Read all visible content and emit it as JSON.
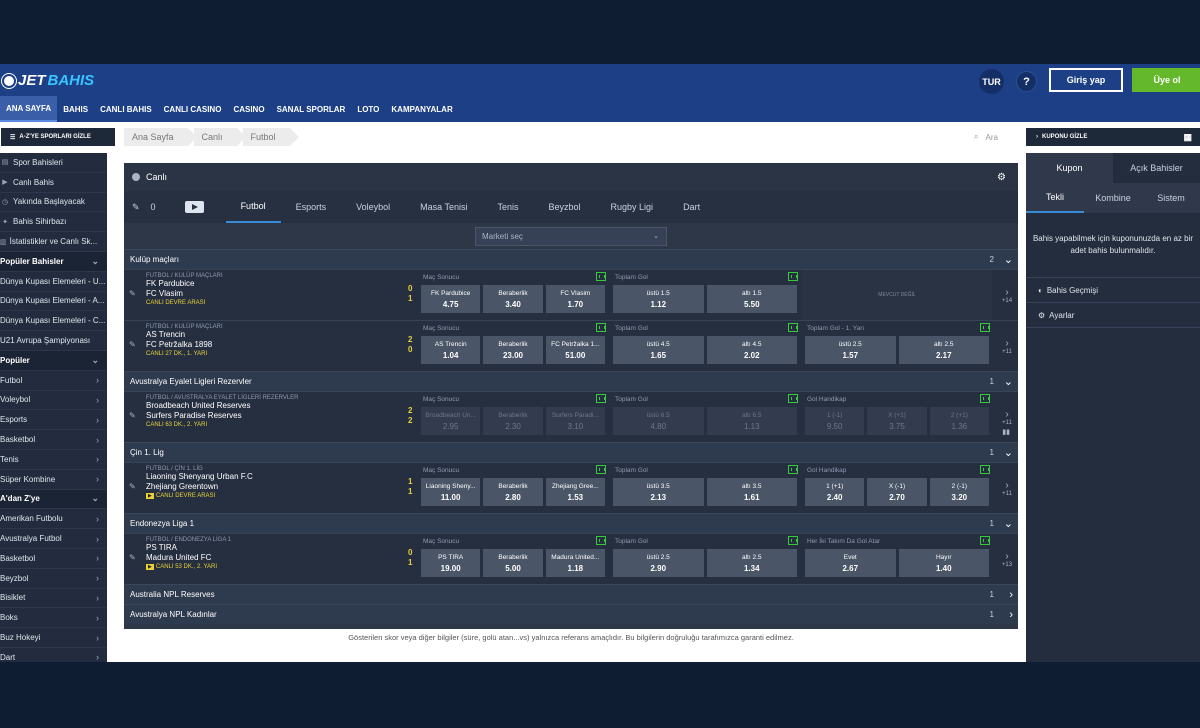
{
  "header": {
    "logo_part1": "JET",
    "logo_part2": "BAHIS",
    "language": "TUR",
    "help": "?",
    "login_label": "Giriş yap",
    "signup_label": "Üye ol"
  },
  "nav": [
    "ANA SAYFA",
    "BAHIS",
    "CANLI BAHIS",
    "CANLI CASINO",
    "CASINO",
    "SANAL SPORLAR",
    "LOTO",
    "KAMPANYALAR"
  ],
  "az_button": "A-Z'YE SPORLARI GİZLE",
  "breadcrumb": [
    "Ana Sayfa",
    "Canlı",
    "Futbol"
  ],
  "search_placeholder": "Ara",
  "kupon_hide": "KUPONU GİZLE",
  "left_menu": [
    {
      "label": "Spor Bahisleri",
      "type": "item",
      "icon": "▤"
    },
    {
      "label": "Canlı Bahis",
      "type": "item",
      "icon": "▶"
    },
    {
      "label": "Yakında Başlayacak",
      "type": "item",
      "icon": "◷"
    },
    {
      "label": "Bahis Sihirbazı",
      "type": "item",
      "icon": "✦"
    },
    {
      "label": "İstatistikler ve Canlı Sk...",
      "type": "item",
      "icon": "▥"
    },
    {
      "label": "Popüler Bahisler",
      "type": "hdr"
    },
    {
      "label": "Dünya Kupası Elemeleri - U...",
      "type": "item"
    },
    {
      "label": "Dünya Kupası Elemeleri - A...",
      "type": "item"
    },
    {
      "label": "Dünya Kupası Elemeleri - C...",
      "type": "item"
    },
    {
      "label": "U21 Avrupa Şampiyonası",
      "type": "item"
    },
    {
      "label": "Popüler",
      "type": "hdr"
    },
    {
      "label": "Futbol",
      "type": "item",
      "chev": true
    },
    {
      "label": "Voleybol",
      "type": "item",
      "chev": true
    },
    {
      "label": "Esports",
      "type": "item",
      "chev": true
    },
    {
      "label": "Basketbol",
      "type": "item",
      "chev": true
    },
    {
      "label": "Tenis",
      "type": "item",
      "chev": true
    },
    {
      "label": "Süper Kombine",
      "type": "item",
      "chev": true
    },
    {
      "label": "A'dan Z'ye",
      "type": "hdr"
    },
    {
      "label": "Amerikan Futbolu",
      "type": "item",
      "chev": true
    },
    {
      "label": "Avustralya Futbol",
      "type": "item",
      "chev": true
    },
    {
      "label": "Basketbol",
      "type": "item",
      "chev": true
    },
    {
      "label": "Beyzbol",
      "type": "item",
      "chev": true
    },
    {
      "label": "Bisiklet",
      "type": "item",
      "chev": true
    },
    {
      "label": "Boks",
      "type": "item",
      "chev": true
    },
    {
      "label": "Buz Hokeyi",
      "type": "item",
      "chev": true
    },
    {
      "label": "Dart",
      "type": "item",
      "chev": true
    }
  ],
  "main": {
    "title": "Canlı",
    "favorites_count": "0",
    "sport_tabs": [
      "Futbol",
      "Esports",
      "Voleybol",
      "Masa Tenisi",
      "Tenis",
      "Beyzbol",
      "Rugby Ligi",
      "Dart"
    ],
    "market_select": "Marketi seç",
    "sections": [
      {
        "league": "Kulüp maçları",
        "count": "2",
        "open": true,
        "matches": [
          {
            "cat": "FUTBOL / KULÜP MAÇLARI",
            "home": "FK Pardubice",
            "away": "FC Vlasim",
            "score_home": "0",
            "score_away": "1",
            "status": "CANLI DEVRE ARASI",
            "tv": false,
            "more": "+14",
            "markets": [
              {
                "title": "Maç Sonucu",
                "odds": [
                  {
                    "l": "FK Pardubice",
                    "v": "4.75"
                  },
                  {
                    "l": "Beraberlik",
                    "v": "3.40"
                  },
                  {
                    "l": "FC Vlasim",
                    "v": "1.70"
                  }
                ]
              },
              {
                "title": "Toplam Gol",
                "odds": [
                  {
                    "l": "üstü 1.5",
                    "v": "1.12"
                  },
                  {
                    "l": "altı 1.5",
                    "v": "5.50"
                  }
                ]
              },
              {
                "title": "",
                "notavail": "MEVCUT DEĞİL"
              }
            ]
          },
          {
            "cat": "FUTBOL / KULÜP MAÇLARI",
            "home": "AS Trencin",
            "away": "FC Petržalka 1898",
            "score_home": "2",
            "score_away": "0",
            "status": "CANLI 27 DK., 1. YARI",
            "tv": false,
            "more": "+11",
            "markets": [
              {
                "title": "Maç Sonucu",
                "odds": [
                  {
                    "l": "AS Trencin",
                    "v": "1.04"
                  },
                  {
                    "l": "Beraberlik",
                    "v": "23.00"
                  },
                  {
                    "l": "FC Petržalka 1...",
                    "v": "51.00"
                  }
                ]
              },
              {
                "title": "Toplam Gol",
                "odds": [
                  {
                    "l": "üstü 4.5",
                    "v": "1.65"
                  },
                  {
                    "l": "altı 4.5",
                    "v": "2.02"
                  }
                ]
              },
              {
                "title": "Toplam Gol - 1. Yarı",
                "odds": [
                  {
                    "l": "üstü 2.5",
                    "v": "1.57"
                  },
                  {
                    "l": "altı 2.5",
                    "v": "2.17"
                  }
                ]
              }
            ]
          }
        ]
      },
      {
        "league": "Avustralya Eyalet Ligleri Rezervler",
        "count": "1",
        "open": true,
        "matches": [
          {
            "cat": "FUTBOL / AVUSTRALYA EYALET LİGLERİ REZERVLER",
            "home": "Broadbeach United Reserves",
            "away": "Surfers Paradise Reserves",
            "score_home": "2",
            "score_away": "2",
            "status": "CANLI 63 DK., 2. YARI",
            "tv": false,
            "more": "+11",
            "bars": true,
            "markets": [
              {
                "title": "Maç Sonucu",
                "disabled": true,
                "odds": [
                  {
                    "l": "Broadbeach Un...",
                    "v": "2.95"
                  },
                  {
                    "l": "Beraberlik",
                    "v": "2.30"
                  },
                  {
                    "l": "Surfers Paradi...",
                    "v": "3.10"
                  }
                ]
              },
              {
                "title": "Toplam Gol",
                "disabled": true,
                "odds": [
                  {
                    "l": "üstü 6.5",
                    "v": "4.80"
                  },
                  {
                    "l": "altı 6.5",
                    "v": "1.13"
                  }
                ]
              },
              {
                "title": "Gol Handikap",
                "disabled": true,
                "odds": [
                  {
                    "l": "1 (-1)",
                    "v": "9.50"
                  },
                  {
                    "l": "X (+1)",
                    "v": "3.75"
                  },
                  {
                    "l": "2 (+1)",
                    "v": "1.36"
                  }
                ]
              }
            ]
          }
        ]
      },
      {
        "league": "Çin 1. Lig",
        "count": "1",
        "open": true,
        "matches": [
          {
            "cat": "FUTBOL / ÇİN 1. LİG",
            "home": "Liaoning Shenyang Urban F.C",
            "away": "Zhejiang Greentown",
            "score_home": "1",
            "score_away": "1",
            "status": "CANLI DEVRE ARASI",
            "tv": true,
            "more": "+11",
            "markets": [
              {
                "title": "Maç Sonucu",
                "odds": [
                  {
                    "l": "Liaoning Sheny...",
                    "v": "11.00"
                  },
                  {
                    "l": "Beraberlik",
                    "v": "2.80"
                  },
                  {
                    "l": "Zhejiang Gree...",
                    "v": "1.53"
                  }
                ]
              },
              {
                "title": "Toplam Gol",
                "odds": [
                  {
                    "l": "üstü 3.5",
                    "v": "2.13"
                  },
                  {
                    "l": "altı 3.5",
                    "v": "1.61"
                  }
                ]
              },
              {
                "title": "Gol Handikap",
                "odds": [
                  {
                    "l": "1 (+1)",
                    "v": "2.40"
                  },
                  {
                    "l": "X (-1)",
                    "v": "2.70"
                  },
                  {
                    "l": "2 (-1)",
                    "v": "3.20"
                  }
                ]
              }
            ]
          }
        ]
      },
      {
        "league": "Endonezya Liga 1",
        "count": "1",
        "open": true,
        "matches": [
          {
            "cat": "FUTBOL / ENDONEZYA LİGA 1",
            "home": "PS TIRA",
            "away": "Madura United FC",
            "score_home": "0",
            "score_away": "1",
            "status": "CANLI 53 DK., 2. YARI",
            "tv": true,
            "more": "+13",
            "markets": [
              {
                "title": "Maç Sonucu",
                "odds": [
                  {
                    "l": "PS TIRA",
                    "v": "19.00"
                  },
                  {
                    "l": "Beraberlik",
                    "v": "5.00"
                  },
                  {
                    "l": "Madura United...",
                    "v": "1.18"
                  }
                ]
              },
              {
                "title": "Toplam Gol",
                "odds": [
                  {
                    "l": "üstü 2.5",
                    "v": "2.90"
                  },
                  {
                    "l": "altı 2.5",
                    "v": "1.34"
                  }
                ]
              },
              {
                "title": "Her İki Takım Da Gol Atar",
                "odds": [
                  {
                    "l": "Evet",
                    "v": "2.67"
                  },
                  {
                    "l": "Hayır",
                    "v": "1.40"
                  }
                ]
              }
            ]
          }
        ]
      },
      {
        "league": "Australia NPL Reserves",
        "count": "1",
        "open": false,
        "matches": []
      },
      {
        "league": "Avustralya NPL Kadınlar",
        "count": "1",
        "open": false,
        "matches": []
      }
    ]
  },
  "disclaimer": "Gösterilen skor veya diğer bilgiler (süre, golü atan...vs) yalnızca referans amaçlıdır. Bu bilgilerin doğruluğu tarafımızca garanti edilmez.",
  "kupon": {
    "tabs": [
      "Kupon",
      "Açık Bahisler"
    ],
    "subtabs": [
      "Tekli",
      "Kombine",
      "Sistem"
    ],
    "empty": "Bahis yapabilmek için kuponunuzda en az bir adet bahis bulunmalıdır.",
    "history": "Bahis Geçmişi",
    "settings": "Ayarlar"
  }
}
